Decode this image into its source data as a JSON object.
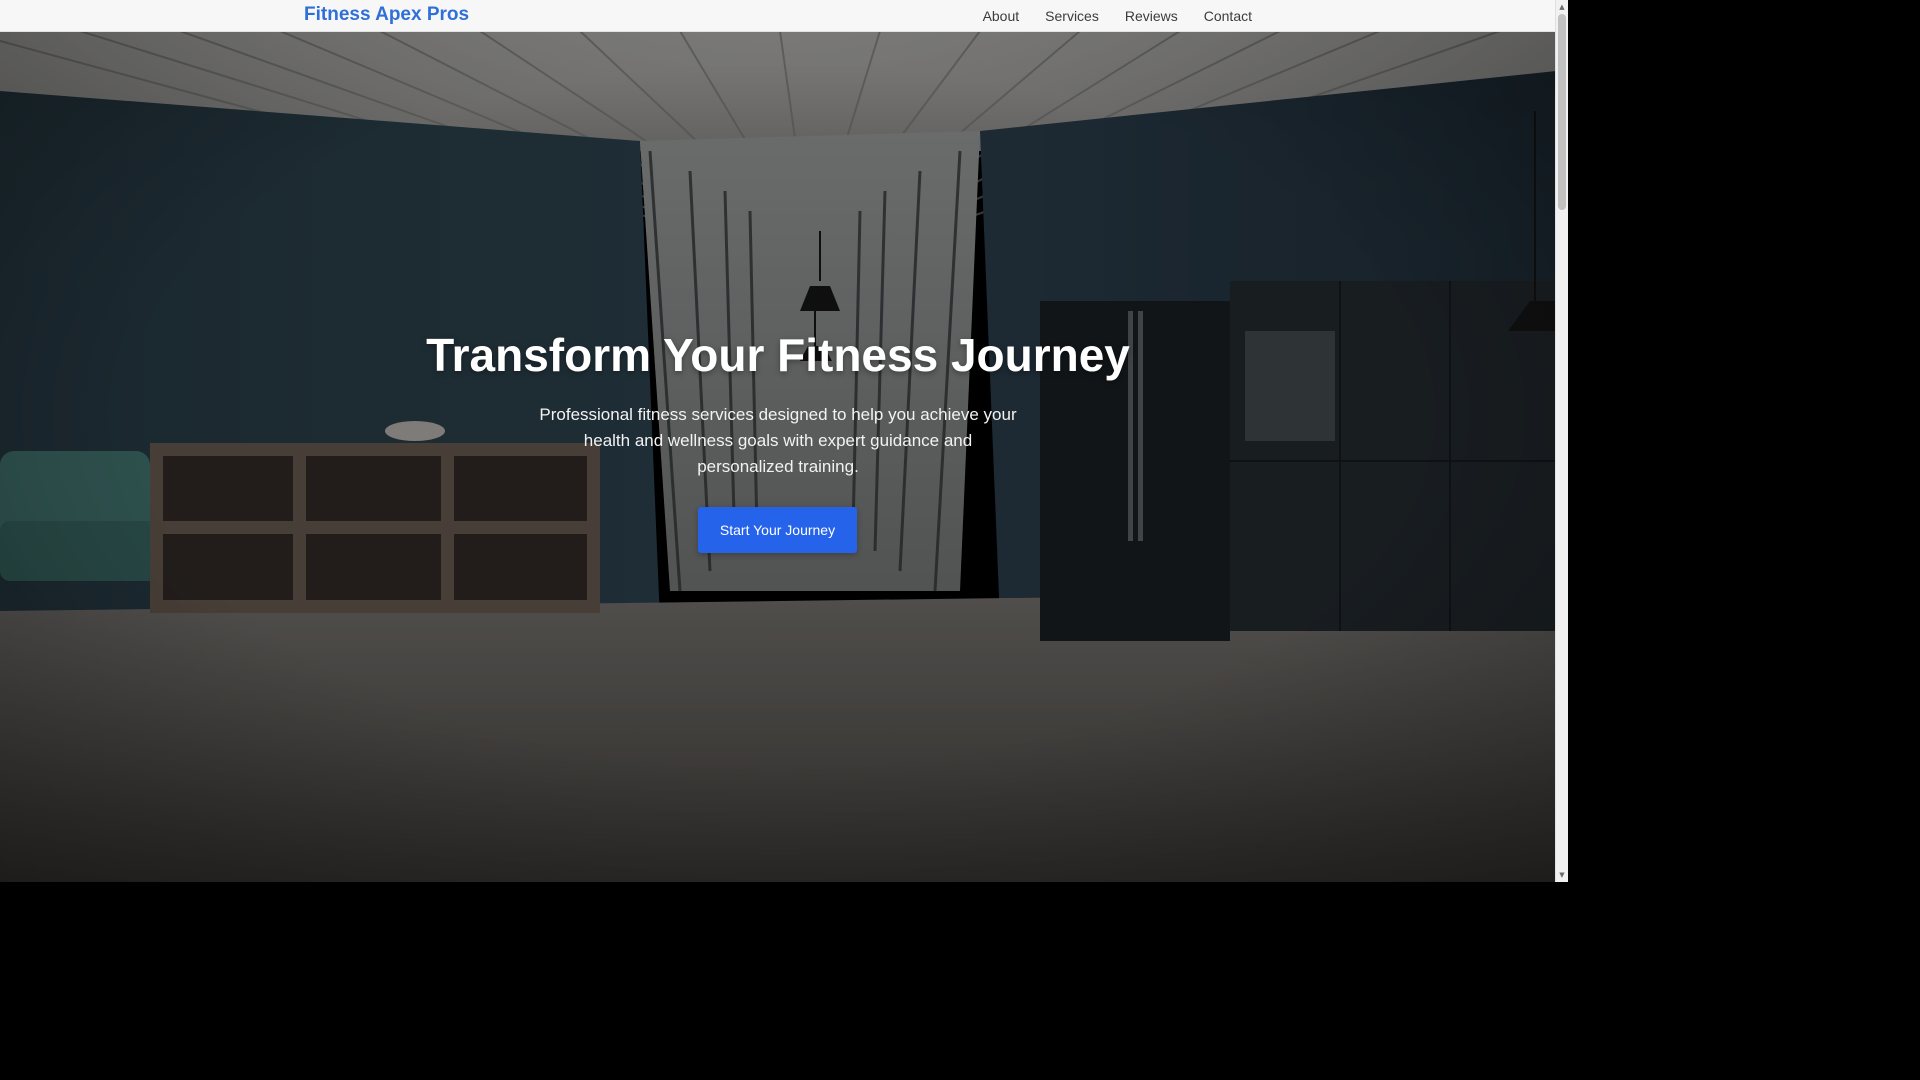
{
  "navbar": {
    "brand": "Fitness Apex Pros",
    "links": [
      {
        "label": "About"
      },
      {
        "label": "Services"
      },
      {
        "label": "Reviews"
      },
      {
        "label": "Contact"
      }
    ]
  },
  "hero": {
    "title": "Transform Your Fitness Journey",
    "subtitle": "Professional fitness services designed to help you achieve your health and wellness goals with expert guidance and personalized training.",
    "cta_label": "Start Your Journey",
    "background_image": "office-kitchen-interior-photo"
  },
  "colors": {
    "brand": "#2f6fd8",
    "cta": "#2563eb",
    "nav_bg": "#f7f7f7"
  },
  "scrollbar": {
    "up_icon": "scroll-up-arrow-icon",
    "down_icon": "scroll-down-arrow-icon"
  }
}
